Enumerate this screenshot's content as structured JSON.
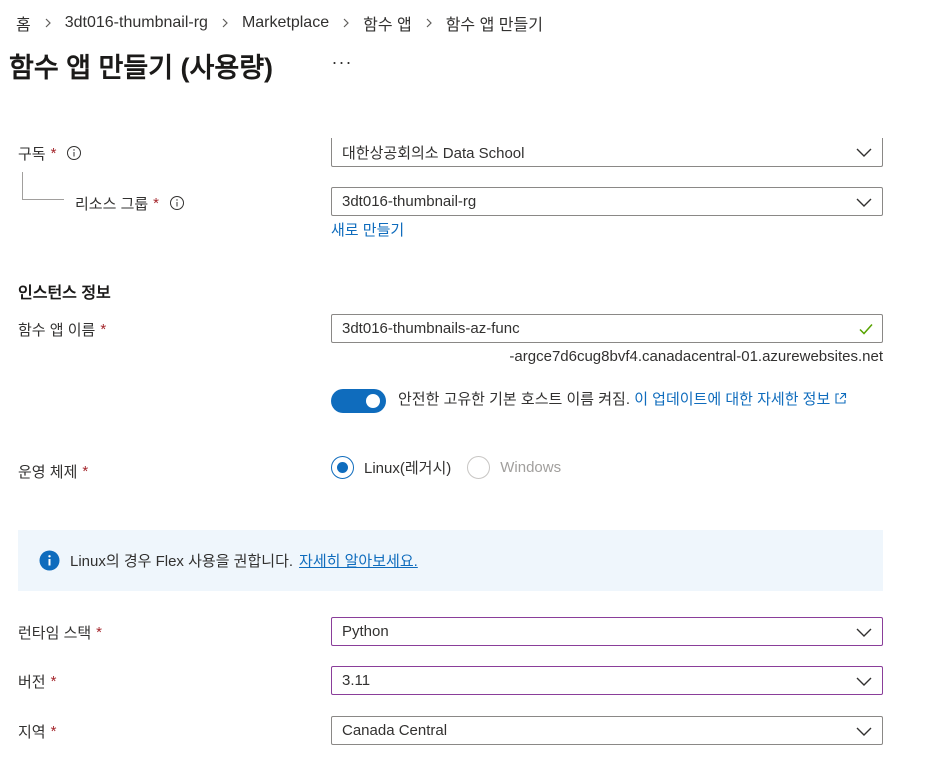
{
  "breadcrumb": [
    "홈",
    "3dt016-thumbnail-rg",
    "Marketplace",
    "함수 앱",
    "함수 앱 만들기"
  ],
  "page": {
    "title": "함수 앱 만들기 (사용량)",
    "more": "···"
  },
  "subscription": {
    "label": "구독",
    "required": "*",
    "value": "대한상공회의소 Data School"
  },
  "resource_group": {
    "label": "리소스 그룹",
    "required": "*",
    "value": "3dt016-thumbnail-rg",
    "new_link": "새로 만들기"
  },
  "instance": {
    "section_title": "인스턴스 정보",
    "app_name": {
      "label": "함수 앱 이름",
      "required": "*",
      "value": "3dt016-thumbnails-az-func",
      "suffix": "-argce7d6cug8bvf4.canadacentral-01.azurewebsites.net"
    },
    "toggle": {
      "text": "안전한 고유한 기본 호스트 이름 켜짐.",
      "link": "이 업데이트에 대한 자세한 정보"
    },
    "os": {
      "label": "운영 체제",
      "required": "*",
      "options": [
        "Linux(레거시)",
        "Windows"
      ],
      "selected": "Linux(레거시)"
    }
  },
  "banner": {
    "text": "Linux의 경우 Flex 사용을 권합니다.",
    "link": "자세히 알아보세요."
  },
  "runtime": {
    "label": "런타임 스택",
    "required": "*",
    "value": "Python"
  },
  "version": {
    "label": "버전",
    "required": "*",
    "value": "3.11"
  },
  "region": {
    "label": "지역",
    "required": "*",
    "value": "Canada Central"
  },
  "colors": {
    "accent": "#0f6cbd",
    "required": "#a4262c",
    "banner_bg": "#eff6fc",
    "focus_border": "#8a3e9a",
    "valid": "#57a300"
  }
}
